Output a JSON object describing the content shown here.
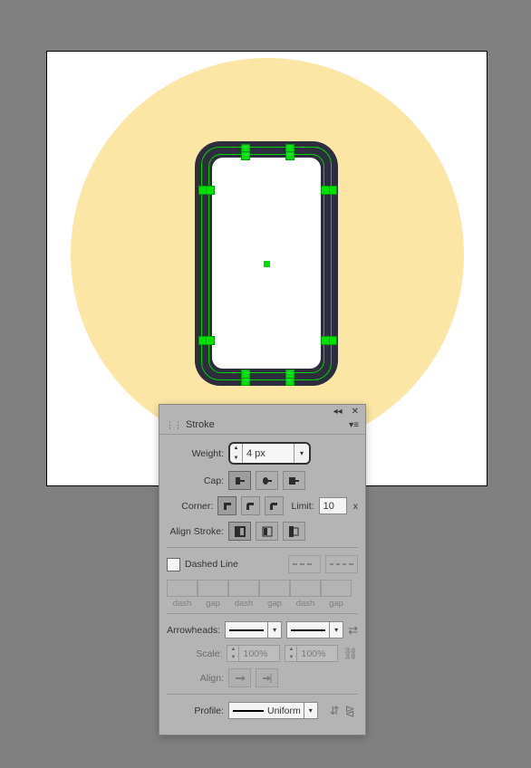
{
  "panel": {
    "title": "Stroke",
    "weight_label": "Weight:",
    "weight_value": "4 px",
    "cap_label": "Cap:",
    "corner_label": "Corner:",
    "limit_label": "Limit:",
    "limit_value": "10",
    "limit_suffix": "x",
    "align_label": "Align Stroke:",
    "dashed_label": "Dashed Line",
    "dash_labels": [
      "dash",
      "gap",
      "dash",
      "gap",
      "dash",
      "gap"
    ],
    "arrow_label": "Arrowheads:",
    "scale_label": "Scale:",
    "scale_value_left": "100%",
    "scale_value_right": "100%",
    "align_arrow_label": "Align:",
    "profile_label": "Profile:",
    "profile_value": "Uniform"
  }
}
